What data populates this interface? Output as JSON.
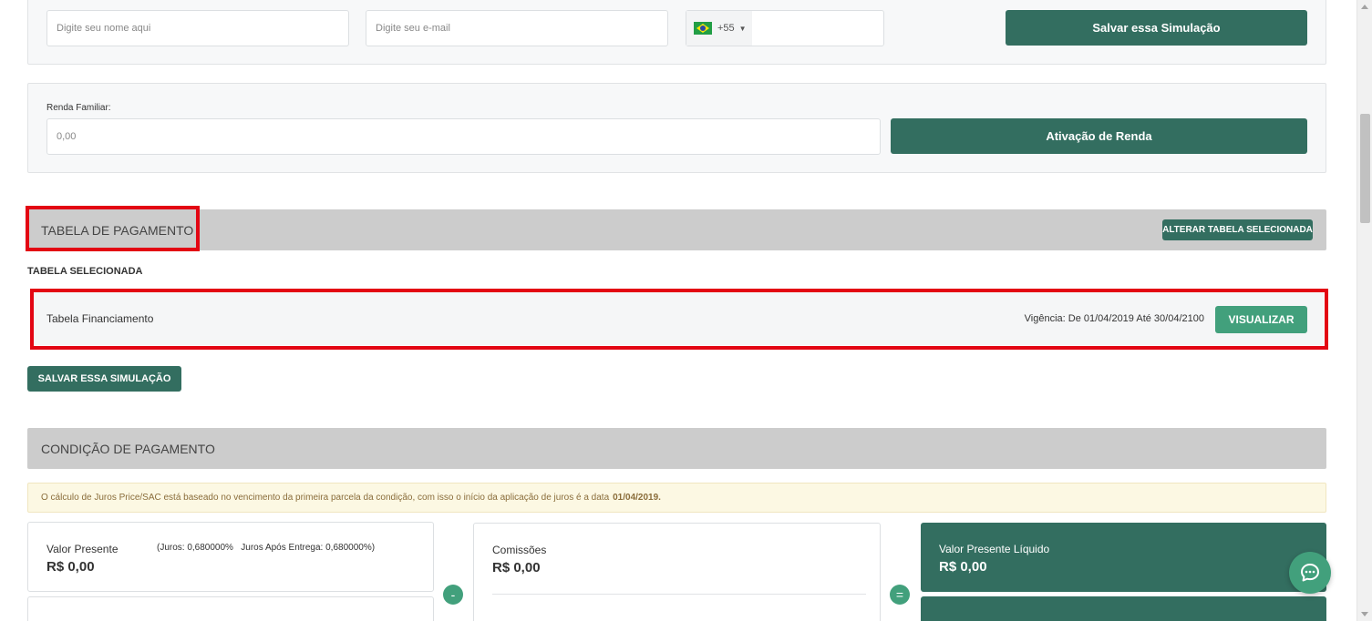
{
  "contact": {
    "name_placeholder": "Digite seu nome aqui",
    "email_placeholder": "Digite seu e-mail",
    "phone_code": "+55",
    "save_button": "Salvar essa Simulação"
  },
  "income": {
    "label": "Renda Familiar:",
    "value": "0,00",
    "activate_button": "Ativação de Renda"
  },
  "payment_table": {
    "title": "TABELA DE PAGAMENTO",
    "change_button": "ALTERAR TABELA SELECIONADA",
    "selected_label": "TABELA SELECIONADA",
    "table_name": "Tabela Financiamento",
    "validity": "Vigência: De 01/04/2019 Até 30/04/2100",
    "view_button": "VISUALIZAR",
    "save_button": "SALVAR ESSA SIMULAÇÃO"
  },
  "payment_condition": {
    "title": "CONDIÇÃO DE PAGAMENTO",
    "notice_text": "O cálculo de Juros Price/SAC está baseado no vencimento da primeira parcela da condição, com isso o início da aplicação de juros é a data",
    "notice_date": "01/04/2019.",
    "present_value": {
      "title": "Valor Presente",
      "rates": "(Juros: 0,680000%   Juros Após Entrega: 0,680000%)",
      "value": "R$ 0,00"
    },
    "commissions": {
      "title": "Comissões",
      "value": "R$ 0,00"
    },
    "net_present_value": {
      "title": "Valor Presente Líquido",
      "value": "R$ 0,00"
    },
    "minus_symbol": "-",
    "equals_symbol": "="
  },
  "icons": {
    "chat": "chat-bubble-icon",
    "flag": "brazil-flag-icon"
  },
  "colors": {
    "primary_dark": "#336e60",
    "primary_light": "#42a07c",
    "highlight_red": "#e30613"
  }
}
